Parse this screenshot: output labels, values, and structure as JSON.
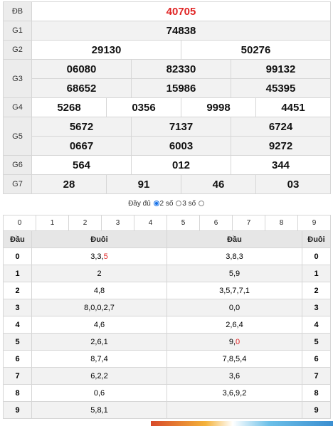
{
  "results": {
    "db": {
      "label": "ĐB",
      "value": "40705"
    },
    "g1": {
      "label": "G1",
      "values": [
        "74838"
      ]
    },
    "g2": {
      "label": "G2",
      "values": [
        "29130",
        "50276"
      ]
    },
    "g3": {
      "label": "G3",
      "values": [
        "06080",
        "82330",
        "99132",
        "68652",
        "15986",
        "45395"
      ]
    },
    "g4": {
      "label": "G4",
      "values": [
        "5268",
        "0356",
        "9998",
        "4451"
      ]
    },
    "g5": {
      "label": "G5",
      "values": [
        "5672",
        "7137",
        "6724",
        "0667",
        "6003",
        "9272"
      ]
    },
    "g6": {
      "label": "G6",
      "values": [
        "564",
        "012",
        "344"
      ]
    },
    "g7": {
      "label": "G7",
      "values": [
        "28",
        "91",
        "46",
        "03"
      ]
    }
  },
  "mode": {
    "full_label": "Đầy đủ",
    "two_label": "2 số",
    "three_label": "3 số",
    "selected": "full"
  },
  "digits": [
    "0",
    "1",
    "2",
    "3",
    "4",
    "5",
    "6",
    "7",
    "8",
    "9"
  ],
  "headtail": {
    "headers": {
      "dau_left": "Đầu",
      "duoi_left": "Đuôi",
      "dau_mid": "Đầu",
      "duoi_right": "Đuôi"
    },
    "rows": [
      {
        "k": "0",
        "duoi": "3,3,",
        "duoi_hl": "5",
        "dau": "3,8,3",
        "dau_hl": ""
      },
      {
        "k": "1",
        "duoi": "2",
        "duoi_hl": "",
        "dau": "5,9",
        "dau_hl": ""
      },
      {
        "k": "2",
        "duoi": "4,8",
        "duoi_hl": "",
        "dau": "3,5,7,7,1",
        "dau_hl": ""
      },
      {
        "k": "3",
        "duoi": "8,0,0,2,7",
        "duoi_hl": "",
        "dau": "0,0",
        "dau_hl": ""
      },
      {
        "k": "4",
        "duoi": "4,6",
        "duoi_hl": "",
        "dau": "2,6,4",
        "dau_hl": ""
      },
      {
        "k": "5",
        "duoi": "2,6,1",
        "duoi_hl": "",
        "dau": "9,",
        "dau_hl": "0"
      },
      {
        "k": "6",
        "duoi": "8,7,4",
        "duoi_hl": "",
        "dau": "7,8,5,4",
        "dau_hl": ""
      },
      {
        "k": "7",
        "duoi": "6,2,2",
        "duoi_hl": "",
        "dau": "3,6",
        "dau_hl": ""
      },
      {
        "k": "8",
        "duoi": "0,6",
        "duoi_hl": "",
        "dau": "3,6,9,2",
        "dau_hl": ""
      },
      {
        "k": "9",
        "duoi": "5,8,1",
        "duoi_hl": "",
        "dau": "",
        "dau_hl": ""
      }
    ]
  }
}
